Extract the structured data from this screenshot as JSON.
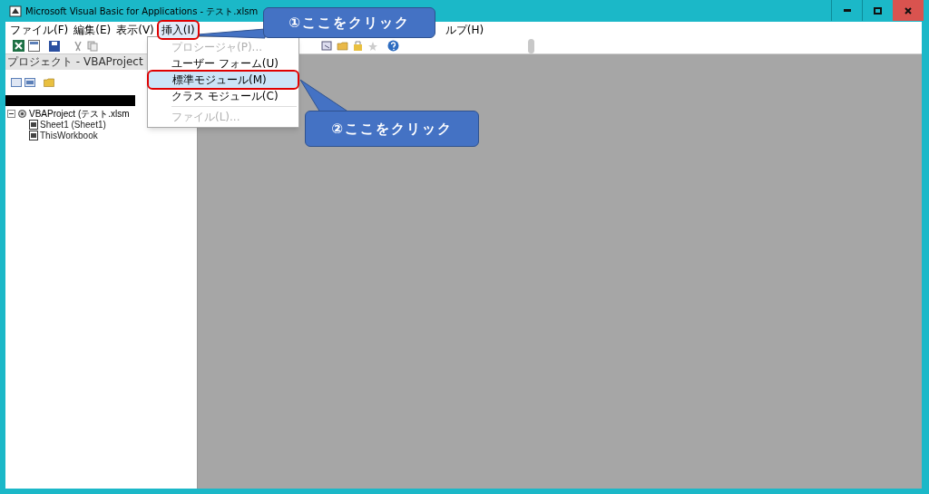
{
  "window": {
    "title": "Microsoft Visual Basic for Applications - テスト.xlsm"
  },
  "menu_bar": [
    {
      "label": "ファイル(F)",
      "selected": false
    },
    {
      "label": "編集(E)",
      "selected": false
    },
    {
      "label": "表示(V)",
      "selected": false
    },
    {
      "label": "挿入(I)",
      "selected": true
    },
    {
      "label": "ルプ(H)",
      "selected": false
    }
  ],
  "insert_menu": [
    {
      "label": "プロシージャ(P)...",
      "disabled": true,
      "selected": false
    },
    {
      "label": "ユーザー フォーム(U)",
      "disabled": false,
      "selected": false
    },
    {
      "label": "標準モジュール(M)",
      "disabled": false,
      "selected": true
    },
    {
      "label": "クラス モジュール(C)",
      "disabled": false,
      "selected": false
    },
    {
      "label": "ファイル(L)...",
      "disabled": true,
      "selected": false
    }
  ],
  "project_pane": {
    "title": "プロジェクト - VBAProject",
    "tree": [
      {
        "label": "VBAProject (テスト.xlsm",
        "expanded": true,
        "children": [
          {
            "label": "Sheet1 (Sheet1)"
          },
          {
            "label": "ThisWorkbook"
          }
        ]
      }
    ]
  },
  "callouts": [
    {
      "text": "①ここをクリック"
    },
    {
      "text": "②ここをクリック"
    }
  ]
}
